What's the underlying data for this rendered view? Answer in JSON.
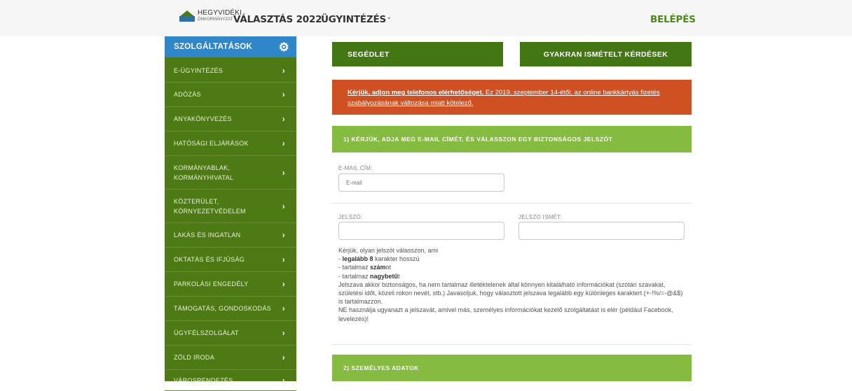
{
  "header": {
    "logo_line1": "HEGYVIDÉKI",
    "logo_line2": "ÖNKORMÁNYZAT",
    "nav_valasztas": "VÁLASZTÁS 2022",
    "nav_ugyintezes": "ÜGYINTÉZÉS",
    "nav_ugyintezes_caret": "˅",
    "login": "BELÉPÉS"
  },
  "sidebar": {
    "title": "SZOLGÁLTATÁSOK",
    "items": [
      {
        "label": "E-ÜGYINTÉZÉS"
      },
      {
        "label": "ADÓZÁS"
      },
      {
        "label": "ANYAKÖNYVEZÉS"
      },
      {
        "label": "HATÓSÁGI ELJÁRÁSOK"
      },
      {
        "label": "KORMÁNYABLAK, KORMÁNYHIVATAL"
      },
      {
        "label": "KÖZTERÜLET, KÖRNYEZETVÉDELEM"
      },
      {
        "label": "LAKÁS ÉS INGATLAN"
      },
      {
        "label": "OKTATÁS ÉS IFJÚSÁG"
      },
      {
        "label": "PARKOLÁSI ENGEDÉLY"
      },
      {
        "label": "TÁMOGATÁS, GONDOSKODÁS"
      },
      {
        "label": "ÜGYFÉLSZOLGÁLAT"
      },
      {
        "label": "ZÖLD IRODA"
      },
      {
        "label": "VÁROSRENDEZÉS"
      }
    ]
  },
  "buttons": {
    "segedlet": "SEGÉDLET",
    "gyik": "GYAKRAN ISMÉTELT KÉRDÉSEK"
  },
  "alert": {
    "bold_underlined": "Kérjük, adjon meg telefonos elérhetőséget.",
    "rest": " Ez 2019. szeptember 14-étől, az online bankkártyás fizetés szabályozásának változása miatt kötelező."
  },
  "section1": {
    "title": "1) KÉRJÜK, ADJA MEG E-MAIL CÍMÉT, ÉS VÁLASSZON EGY BIZTONSÁGOS JELSZÓT",
    "email_label": "E-MAIL CÍM:",
    "email_placeholder": "E-mail",
    "password_label": "JELSZÓ:",
    "password_repeat_label": "JELSZO ISMÉT:"
  },
  "help": {
    "intro": "Kérjük, olyan jelszót válasszon, ami",
    "r1_prefix": "- ",
    "r1_bold": "legalább 8",
    "r1_rest": " karakter hosszú",
    "r2_prefix": "- tartalmaz ",
    "r2_bold": "szám",
    "r2_rest": "ot",
    "r3_prefix": "- tartalmaz ",
    "r3_bold": "nagybetű",
    "r3_rest": "t",
    "p1": "Jelszava akkor biztonságos, ha nem tartalmaz illetéktelenek által könnyen kitalálható információkat (szótári szavakat, születési időt, közeli rokon nevét, stb.) Javasoljuk, hogy választott jelszava legalább egy különleges karaktert (+-!%/=-@&$) is tartalmazzon.",
    "p2": "NE használja ugyanazt a jelszavát, amivel más, személyes információkat kezelő szolgáltatást is elér (például Facebook, levelezés)!"
  },
  "section2": {
    "title": "2) SZEMÉLYES ADATOK"
  },
  "colors": {
    "sidebar_green": "#4e7a15",
    "button_green": "#437714",
    "section_green": "#86bb41",
    "alert_orange": "#cf5123",
    "sidebar_header_blue": "#2f86c9"
  },
  "icons": {
    "sidebar_header": "gears-icon",
    "sidebar_item": "chevron-right-icon",
    "nav_dropdown": "chevron-down-icon"
  }
}
